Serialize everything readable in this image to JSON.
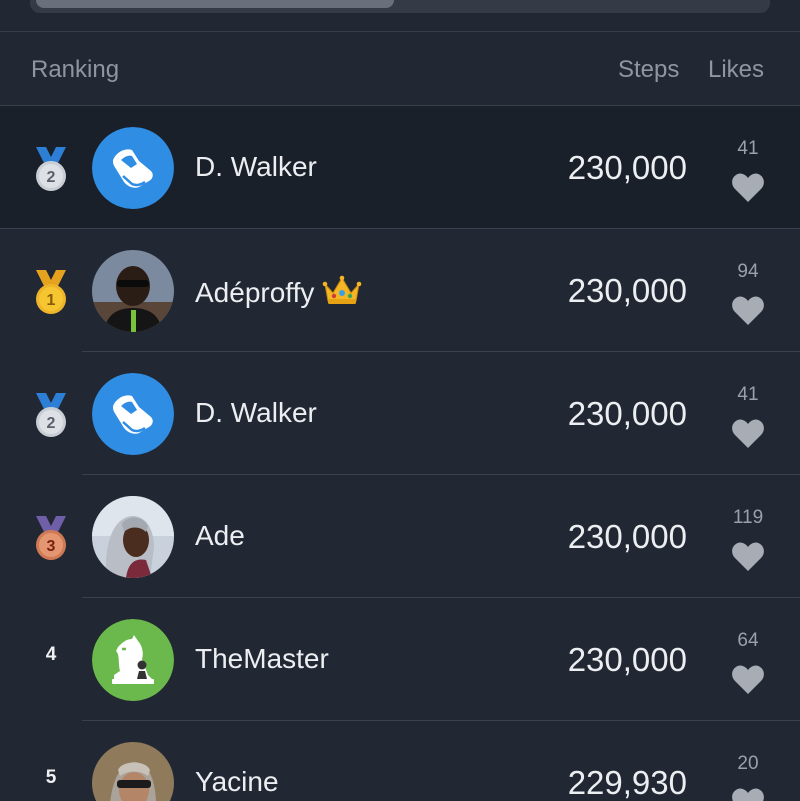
{
  "header": {
    "ranking_label": "Ranking",
    "steps_label": "Steps",
    "likes_label": "Likes"
  },
  "rows": [
    {
      "rank": "2",
      "medal": "silver",
      "name": "D. Walker",
      "avatar": "shoe-avatar",
      "crown": false,
      "steps": "230,000",
      "likes": "41",
      "is_current_user": true
    },
    {
      "rank": "1",
      "medal": "gold",
      "name": "Adéproffy",
      "avatar": "photo-avatar",
      "crown": true,
      "steps": "230,000",
      "likes": "94",
      "is_current_user": false
    },
    {
      "rank": "2",
      "medal": "silver",
      "name": "D. Walker",
      "avatar": "shoe-avatar",
      "crown": false,
      "steps": "230,000",
      "likes": "41",
      "is_current_user": false
    },
    {
      "rank": "3",
      "medal": "bronze",
      "name": "Ade",
      "avatar": "photo-avatar",
      "crown": false,
      "steps": "230,000",
      "likes": "119",
      "is_current_user": false
    },
    {
      "rank": "4",
      "medal": "none",
      "name": "TheMaster",
      "avatar": "chess-avatar",
      "crown": false,
      "steps": "230,000",
      "likes": "64",
      "is_current_user": false
    },
    {
      "rank": "5",
      "medal": "none",
      "name": "Yacine",
      "avatar": "photo-avatar",
      "crown": false,
      "steps": "229,930",
      "likes": "20",
      "is_current_user": false
    }
  ],
  "colors": {
    "background": "#222833",
    "current_user_row": "#1a2029",
    "avatar_blue": "#2f8de4",
    "avatar_green": "#6bb84d",
    "gold": "#f3bd2b",
    "silver": "#d5d9de",
    "bronze": "#d9855f"
  }
}
